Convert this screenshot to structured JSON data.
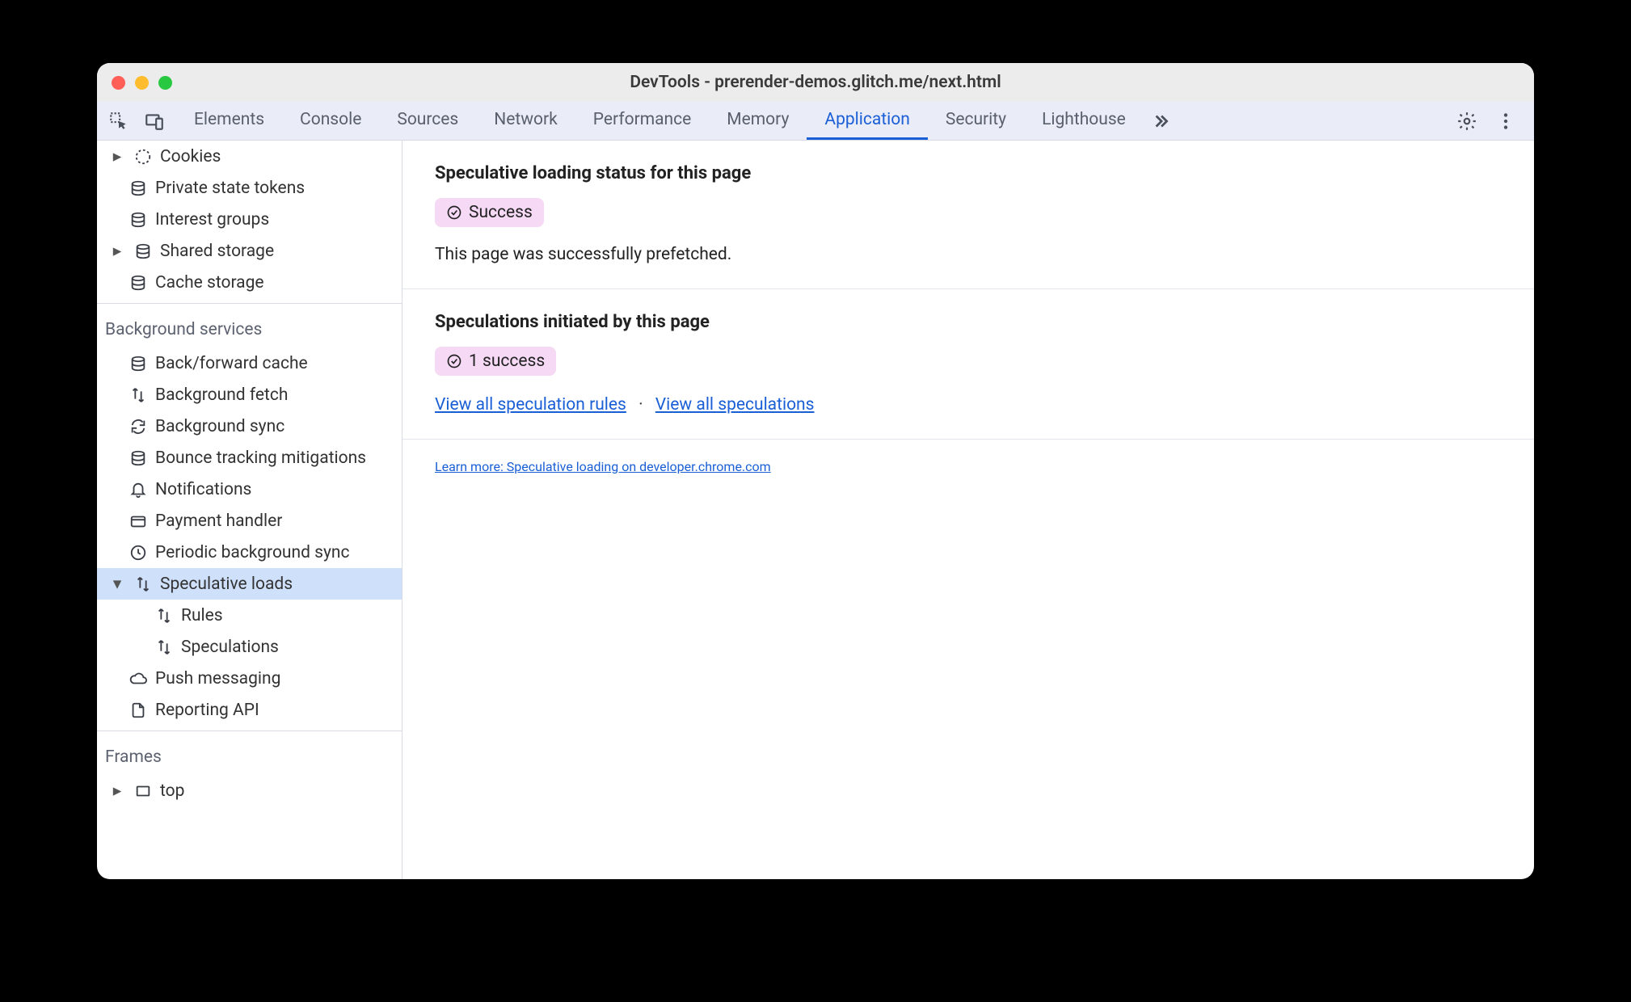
{
  "window": {
    "title": "DevTools - prerender-demos.glitch.me/next.html"
  },
  "tabs": {
    "items": [
      "Elements",
      "Console",
      "Sources",
      "Network",
      "Performance",
      "Memory",
      "Application",
      "Security",
      "Lighthouse"
    ],
    "active": "Application"
  },
  "sidebar": {
    "storage": [
      {
        "label": "Cookies",
        "icon": "cookie",
        "arrow": true
      },
      {
        "label": "Private state tokens",
        "icon": "db"
      },
      {
        "label": "Interest groups",
        "icon": "db"
      },
      {
        "label": "Shared storage",
        "icon": "db",
        "arrow": true
      },
      {
        "label": "Cache storage",
        "icon": "db"
      }
    ],
    "bg_title": "Background services",
    "bg": [
      {
        "label": "Back/forward cache",
        "icon": "db"
      },
      {
        "label": "Background fetch",
        "icon": "updown"
      },
      {
        "label": "Background sync",
        "icon": "sync"
      },
      {
        "label": "Bounce tracking mitigations",
        "icon": "db"
      },
      {
        "label": "Notifications",
        "icon": "bell"
      },
      {
        "label": "Payment handler",
        "icon": "card"
      },
      {
        "label": "Periodic background sync",
        "icon": "clock"
      },
      {
        "label": "Speculative loads",
        "icon": "updown",
        "arrow": true,
        "expanded": true,
        "selected": true,
        "children": [
          {
            "label": "Rules",
            "icon": "updown"
          },
          {
            "label": "Speculations",
            "icon": "updown"
          }
        ]
      },
      {
        "label": "Push messaging",
        "icon": "cloud"
      },
      {
        "label": "Reporting API",
        "icon": "page"
      }
    ],
    "frames_title": "Frames",
    "frames": [
      {
        "label": "top",
        "icon": "frame",
        "arrow": true
      }
    ]
  },
  "main": {
    "status_heading": "Speculative loading status for this page",
    "status_badge": "Success",
    "status_desc": "This page was successfully prefetched.",
    "spec_heading": "Speculations initiated by this page",
    "spec_badge": "1 success",
    "link_rules": "View all speculation rules",
    "link_specs": "View all speculations",
    "learn_more": "Learn more: Speculative loading on developer.chrome.com"
  }
}
